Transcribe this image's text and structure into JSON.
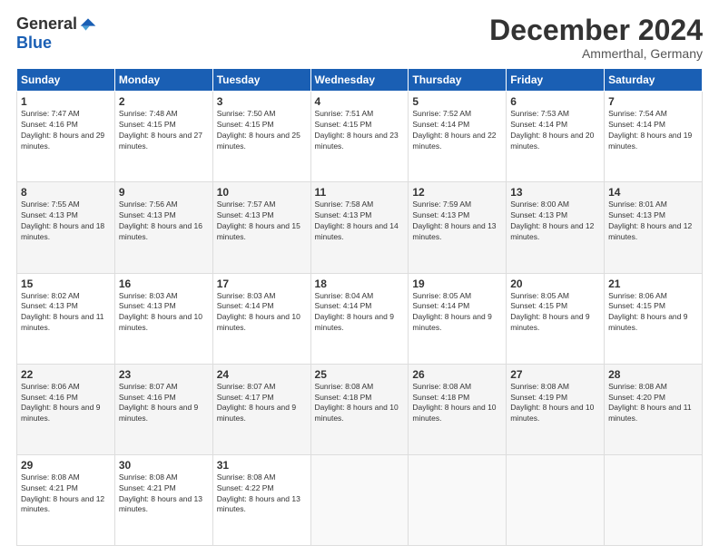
{
  "logo": {
    "general": "General",
    "blue": "Blue"
  },
  "title": "December 2024",
  "subtitle": "Ammerthal, Germany",
  "days_header": [
    "Sunday",
    "Monday",
    "Tuesday",
    "Wednesday",
    "Thursday",
    "Friday",
    "Saturday"
  ],
  "weeks": [
    [
      {
        "day": "1",
        "sunrise": "7:47 AM",
        "sunset": "4:16 PM",
        "daylight": "8 hours and 29 minutes."
      },
      {
        "day": "2",
        "sunrise": "7:48 AM",
        "sunset": "4:15 PM",
        "daylight": "8 hours and 27 minutes."
      },
      {
        "day": "3",
        "sunrise": "7:50 AM",
        "sunset": "4:15 PM",
        "daylight": "8 hours and 25 minutes."
      },
      {
        "day": "4",
        "sunrise": "7:51 AM",
        "sunset": "4:15 PM",
        "daylight": "8 hours and 23 minutes."
      },
      {
        "day": "5",
        "sunrise": "7:52 AM",
        "sunset": "4:14 PM",
        "daylight": "8 hours and 22 minutes."
      },
      {
        "day": "6",
        "sunrise": "7:53 AM",
        "sunset": "4:14 PM",
        "daylight": "8 hours and 20 minutes."
      },
      {
        "day": "7",
        "sunrise": "7:54 AM",
        "sunset": "4:14 PM",
        "daylight": "8 hours and 19 minutes."
      }
    ],
    [
      {
        "day": "8",
        "sunrise": "7:55 AM",
        "sunset": "4:13 PM",
        "daylight": "8 hours and 18 minutes."
      },
      {
        "day": "9",
        "sunrise": "7:56 AM",
        "sunset": "4:13 PM",
        "daylight": "8 hours and 16 minutes."
      },
      {
        "day": "10",
        "sunrise": "7:57 AM",
        "sunset": "4:13 PM",
        "daylight": "8 hours and 15 minutes."
      },
      {
        "day": "11",
        "sunrise": "7:58 AM",
        "sunset": "4:13 PM",
        "daylight": "8 hours and 14 minutes."
      },
      {
        "day": "12",
        "sunrise": "7:59 AM",
        "sunset": "4:13 PM",
        "daylight": "8 hours and 13 minutes."
      },
      {
        "day": "13",
        "sunrise": "8:00 AM",
        "sunset": "4:13 PM",
        "daylight": "8 hours and 12 minutes."
      },
      {
        "day": "14",
        "sunrise": "8:01 AM",
        "sunset": "4:13 PM",
        "daylight": "8 hours and 12 minutes."
      }
    ],
    [
      {
        "day": "15",
        "sunrise": "8:02 AM",
        "sunset": "4:13 PM",
        "daylight": "8 hours and 11 minutes."
      },
      {
        "day": "16",
        "sunrise": "8:03 AM",
        "sunset": "4:13 PM",
        "daylight": "8 hours and 10 minutes."
      },
      {
        "day": "17",
        "sunrise": "8:03 AM",
        "sunset": "4:14 PM",
        "daylight": "8 hours and 10 minutes."
      },
      {
        "day": "18",
        "sunrise": "8:04 AM",
        "sunset": "4:14 PM",
        "daylight": "8 hours and 9 minutes."
      },
      {
        "day": "19",
        "sunrise": "8:05 AM",
        "sunset": "4:14 PM",
        "daylight": "8 hours and 9 minutes."
      },
      {
        "day": "20",
        "sunrise": "8:05 AM",
        "sunset": "4:15 PM",
        "daylight": "8 hours and 9 minutes."
      },
      {
        "day": "21",
        "sunrise": "8:06 AM",
        "sunset": "4:15 PM",
        "daylight": "8 hours and 9 minutes."
      }
    ],
    [
      {
        "day": "22",
        "sunrise": "8:06 AM",
        "sunset": "4:16 PM",
        "daylight": "8 hours and 9 minutes."
      },
      {
        "day": "23",
        "sunrise": "8:07 AM",
        "sunset": "4:16 PM",
        "daylight": "8 hours and 9 minutes."
      },
      {
        "day": "24",
        "sunrise": "8:07 AM",
        "sunset": "4:17 PM",
        "daylight": "8 hours and 9 minutes."
      },
      {
        "day": "25",
        "sunrise": "8:08 AM",
        "sunset": "4:18 PM",
        "daylight": "8 hours and 10 minutes."
      },
      {
        "day": "26",
        "sunrise": "8:08 AM",
        "sunset": "4:18 PM",
        "daylight": "8 hours and 10 minutes."
      },
      {
        "day": "27",
        "sunrise": "8:08 AM",
        "sunset": "4:19 PM",
        "daylight": "8 hours and 10 minutes."
      },
      {
        "day": "28",
        "sunrise": "8:08 AM",
        "sunset": "4:20 PM",
        "daylight": "8 hours and 11 minutes."
      }
    ],
    [
      {
        "day": "29",
        "sunrise": "8:08 AM",
        "sunset": "4:21 PM",
        "daylight": "8 hours and 12 minutes."
      },
      {
        "day": "30",
        "sunrise": "8:08 AM",
        "sunset": "4:21 PM",
        "daylight": "8 hours and 13 minutes."
      },
      {
        "day": "31",
        "sunrise": "8:08 AM",
        "sunset": "4:22 PM",
        "daylight": "8 hours and 13 minutes."
      },
      null,
      null,
      null,
      null
    ]
  ]
}
